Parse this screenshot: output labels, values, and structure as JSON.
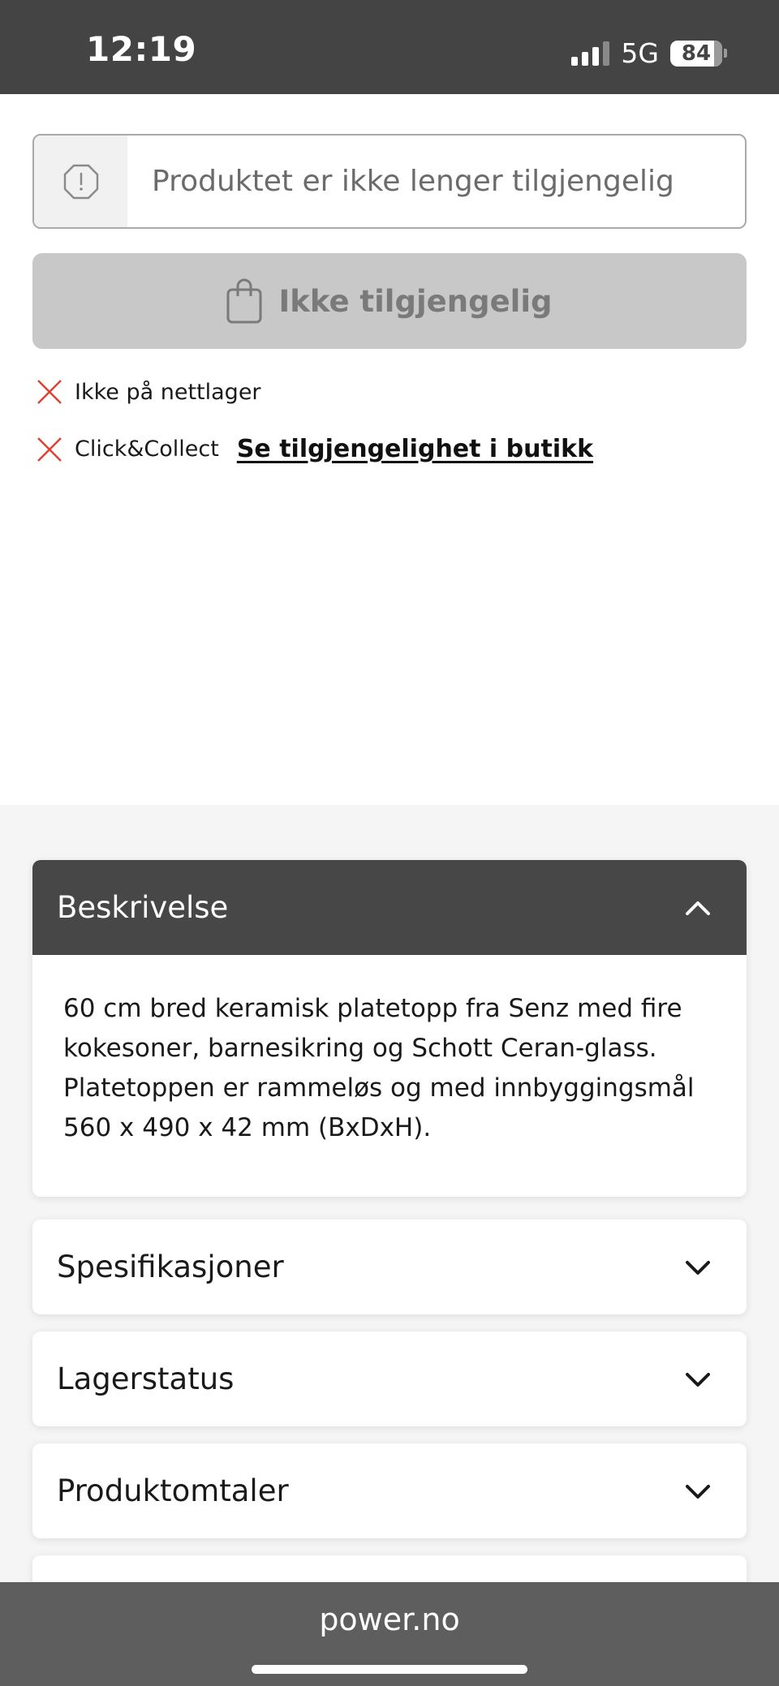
{
  "status_bar": {
    "time": "12:19",
    "network": "5G",
    "battery": "84"
  },
  "availability": {
    "notice": "Produktet er ikke lenger tilgjengelig",
    "button_label": "Ikke tilgjengelig",
    "online_label": "Ikke på nettlager",
    "click_collect_label": "Click&Collect",
    "store_link": "Se tilgjengelighet i butikk"
  },
  "accordions": {
    "description": {
      "title": "Beskrivelse",
      "body": "60 cm bred keramisk platetopp fra Senz med fire kokesoner, barnesikring og Schott Ceran-glass. Platetoppen er rammeløs og med innbyggingsmål 560 x 490 x 42 mm (BxDxH)."
    },
    "specifications": {
      "title": "Spesifikasjoner"
    },
    "stock_status": {
      "title": "Lagerstatus"
    },
    "reviews": {
      "title": "Produktomtaler"
    }
  },
  "browser": {
    "url": "power.no"
  }
}
